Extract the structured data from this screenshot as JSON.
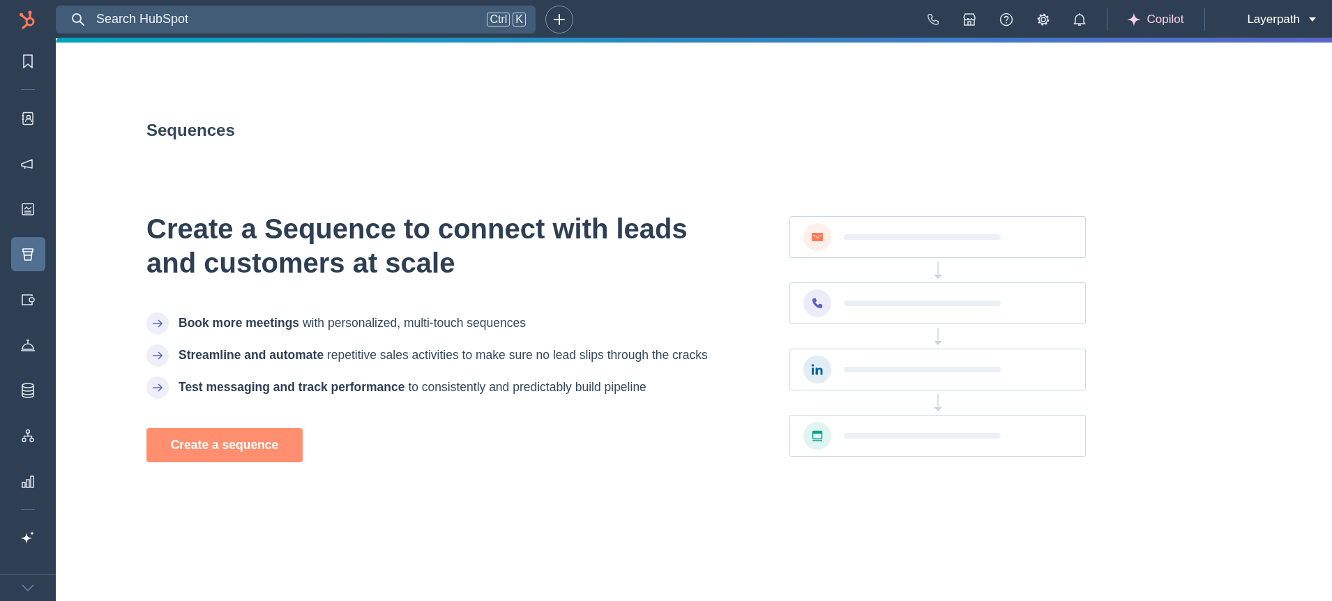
{
  "topbar": {
    "search": {
      "placeholder": "Search HubSpot",
      "shortcut": [
        "Ctrl",
        "K"
      ]
    },
    "copilot": "Copilot",
    "account": "Layerpath"
  },
  "sidebar": {
    "items": [
      {
        "selected": false
      },
      {
        "selected": false
      },
      {
        "selected": false
      },
      {
        "selected": false
      },
      {
        "selected": true
      },
      {
        "selected": false
      },
      {
        "selected": false
      },
      {
        "selected": false
      },
      {
        "selected": false
      },
      {
        "selected": false
      },
      {
        "selected": false
      }
    ]
  },
  "page": {
    "title": "Sequences",
    "headline": "Create a Sequence to connect with leads and customers at scale",
    "benefits": [
      "**Book more meetings** with personalized, multi-touch sequences",
      "**Streamline and automate** repetitive sales activities to make sure no lead slips through the cracks",
      "**Test messaging and track performance** to consistently and predictably build pipeline"
    ],
    "cta": "Create a sequence"
  },
  "illustration": {
    "steps": [
      {
        "color": "#ff7a59"
      },
      {
        "color": "#5c62c5"
      },
      {
        "color": "#0a66a8"
      },
      {
        "color": "#00a38d"
      }
    ]
  }
}
